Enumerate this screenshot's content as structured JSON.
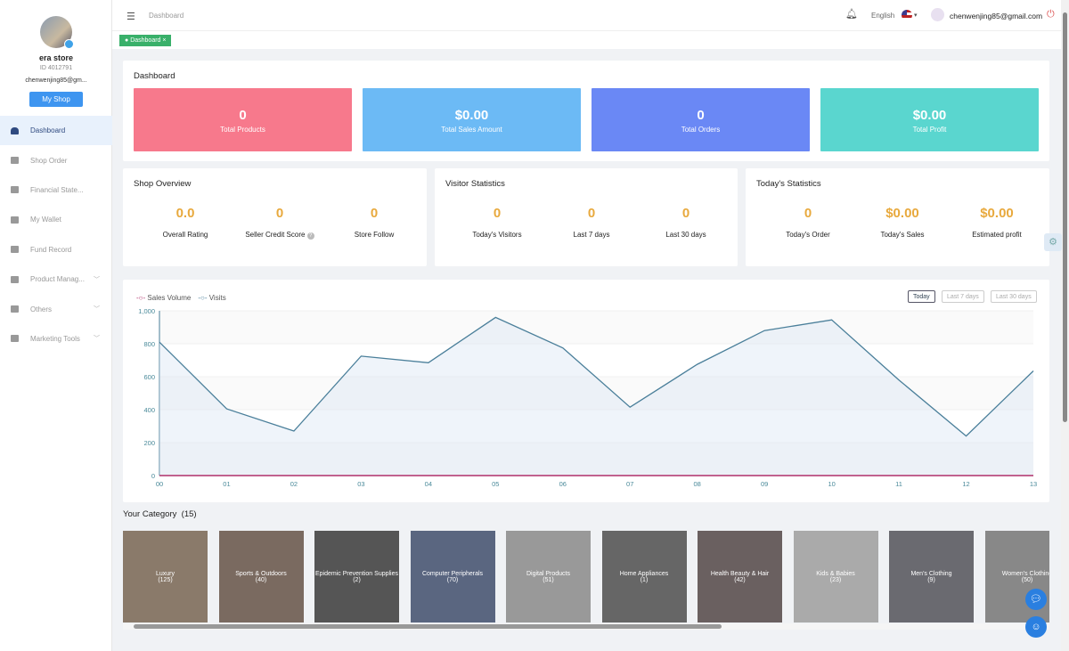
{
  "sidebar": {
    "store_name": "era store",
    "store_id": "ID 4012791",
    "email": "chenwenjing85@gm...",
    "my_shop": "My Shop",
    "items": [
      {
        "label": "Dashboard"
      },
      {
        "label": "Shop Order"
      },
      {
        "label": "Financial State..."
      },
      {
        "label": "My Wallet"
      },
      {
        "label": "Fund Record"
      },
      {
        "label": "Product Manag...",
        "expandable": true
      },
      {
        "label": "Others",
        "expandable": true
      },
      {
        "label": "Marketing Tools",
        "expandable": true
      }
    ]
  },
  "header": {
    "breadcrumb": "Dashboard",
    "language": "English",
    "user_email": "chenwenjing85@gmail.com"
  },
  "tabs": [
    {
      "label": "Dashboard",
      "close": "×"
    }
  ],
  "dashboard": {
    "title": "Dashboard",
    "stats": [
      {
        "value": "0",
        "label": "Total Products",
        "color": "#f7798c"
      },
      {
        "value": "$0.00",
        "label": "Total Sales Amount",
        "color": "#6cbaf5"
      },
      {
        "value": "0",
        "label": "Total Orders",
        "color": "#6a88f5"
      },
      {
        "value": "$0.00",
        "label": "Total Profit",
        "color": "#5ad6cf"
      }
    ]
  },
  "shop_overview": {
    "title": "Shop Overview",
    "metrics": [
      {
        "value": "0.0",
        "label": "Overall Rating"
      },
      {
        "value": "0",
        "label": "Seller Credit Score"
      },
      {
        "value": "0",
        "label": "Store Follow"
      }
    ]
  },
  "visitor_statistics": {
    "title": "Visitor Statistics",
    "metrics": [
      {
        "value": "0",
        "label": "Today's Visitors"
      },
      {
        "value": "0",
        "label": "Last 7 days"
      },
      {
        "value": "0",
        "label": "Last 30 days"
      }
    ]
  },
  "todays_statistics": {
    "title": "Today's Statistics",
    "metrics": [
      {
        "value": "0",
        "label": "Today's Order"
      },
      {
        "value": "$0.00",
        "label": "Today's Sales"
      },
      {
        "value": "$0.00",
        "label": "Estimated profit"
      }
    ]
  },
  "range_buttons": [
    {
      "label": "Today",
      "active": true
    },
    {
      "label": "Last 7 days"
    },
    {
      "label": "Last 30 days"
    }
  ],
  "chart_data": {
    "type": "line",
    "x": [
      "00",
      "01",
      "02",
      "03",
      "04",
      "05",
      "06",
      "07",
      "08",
      "09",
      "10",
      "11",
      "12",
      "13"
    ],
    "ylim": [
      0,
      1000
    ],
    "yticks": [
      "0",
      "200",
      "400",
      "600",
      "800",
      "1,000"
    ],
    "legend": "top-left",
    "series": [
      {
        "name": "Sales Volume",
        "color": "#b0306a",
        "values": [
          0,
          0,
          0,
          0,
          0,
          0,
          0,
          0,
          0,
          0,
          0,
          0,
          0,
          0
        ]
      },
      {
        "name": "Visits",
        "color": "#4a7f9a",
        "values": [
          810,
          405,
          270,
          725,
          685,
          960,
          775,
          415,
          675,
          880,
          945,
          580,
          240,
          635
        ]
      }
    ]
  },
  "categories": {
    "title": "Your Category",
    "count": "(15)",
    "items": [
      {
        "name": "Luxury",
        "count": "(125)"
      },
      {
        "name": "Sports & Outdoors",
        "count": "(40)"
      },
      {
        "name": "Epidemic Prevention Supplies",
        "count": "(2)"
      },
      {
        "name": "Computer Peripherals",
        "count": "(70)"
      },
      {
        "name": "Digital Products",
        "count": "(51)"
      },
      {
        "name": "Home Appliances",
        "count": "(1)"
      },
      {
        "name": "Health Beauty & Hair",
        "count": "(42)"
      },
      {
        "name": "Kids & Babies",
        "count": "(23)"
      },
      {
        "name": "Men's Clothing",
        "count": "(9)"
      },
      {
        "name": "Women's Clothing",
        "count": "(50)"
      }
    ]
  }
}
